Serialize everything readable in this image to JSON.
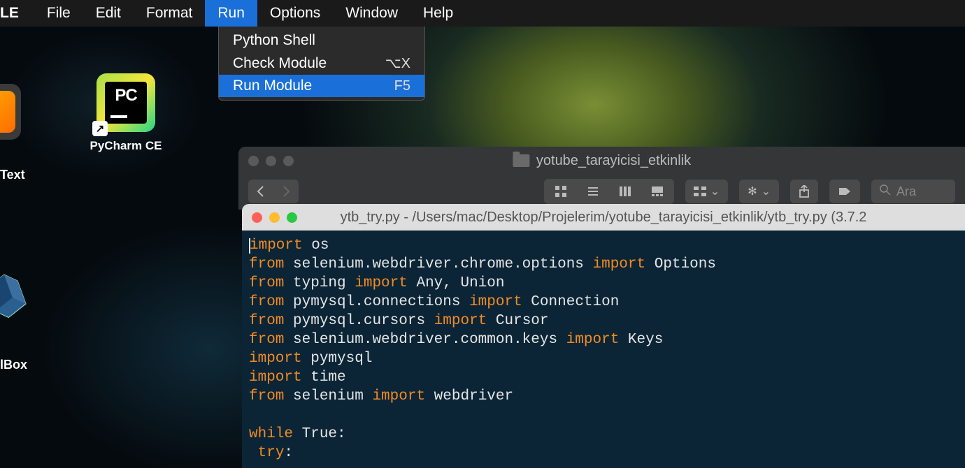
{
  "menubar": {
    "app": "LE",
    "items": [
      "File",
      "Edit",
      "Format",
      "Run",
      "Options",
      "Window",
      "Help"
    ],
    "active_index": 3
  },
  "dropdown": {
    "items": [
      {
        "label": "Python Shell",
        "shortcut": ""
      },
      {
        "label": "Check Module",
        "shortcut": "⌥X"
      },
      {
        "label": "Run Module",
        "shortcut": "F5"
      }
    ],
    "highlight_index": 2
  },
  "desktop": {
    "pycharm_label": "PyCharm CE",
    "sublime_label": "Text",
    "vbox_label": "lBox",
    "pycharm_badge": "PC"
  },
  "finder": {
    "title": "yotube_tarayicisi_etkinlik",
    "search_placeholder": "Ara",
    "icons": {
      "back": "‹",
      "forward": "›",
      "grid": "grid-view-icon",
      "list": "list-view-icon",
      "columns": "columns-view-icon",
      "gallery": "gallery-view-icon",
      "arrange": "arrange-icon",
      "action": "gear-icon",
      "share": "share-icon",
      "tags": "tag-icon",
      "search": "search-icon"
    }
  },
  "editor": {
    "title": "ytb_try.py - /Users/mac/Desktop/Projelerim/yotube_tarayicisi_etkinlik/ytb_try.py (3.7.2",
    "code_tokens": [
      [
        {
          "t": "kw",
          "v": "import"
        },
        {
          "t": "nm",
          "v": " os"
        }
      ],
      [
        {
          "t": "kw",
          "v": "from"
        },
        {
          "t": "nm",
          "v": " selenium.webdriver.chrome.options "
        },
        {
          "t": "kw",
          "v": "import"
        },
        {
          "t": "nm",
          "v": " Options"
        }
      ],
      [
        {
          "t": "kw",
          "v": "from"
        },
        {
          "t": "nm",
          "v": " typing "
        },
        {
          "t": "kw",
          "v": "import"
        },
        {
          "t": "nm",
          "v": " Any, Union"
        }
      ],
      [
        {
          "t": "kw",
          "v": "from"
        },
        {
          "t": "nm",
          "v": " pymysql.connections "
        },
        {
          "t": "kw",
          "v": "import"
        },
        {
          "t": "nm",
          "v": " Connection"
        }
      ],
      [
        {
          "t": "kw",
          "v": "from"
        },
        {
          "t": "nm",
          "v": " pymysql.cursors "
        },
        {
          "t": "kw",
          "v": "import"
        },
        {
          "t": "nm",
          "v": " Cursor"
        }
      ],
      [
        {
          "t": "kw",
          "v": "from"
        },
        {
          "t": "nm",
          "v": " selenium.webdriver.common.keys "
        },
        {
          "t": "kw",
          "v": "import"
        },
        {
          "t": "nm",
          "v": " Keys"
        }
      ],
      [
        {
          "t": "kw",
          "v": "import"
        },
        {
          "t": "nm",
          "v": " pymysql"
        }
      ],
      [
        {
          "t": "kw",
          "v": "import"
        },
        {
          "t": "nm",
          "v": " time"
        }
      ],
      [
        {
          "t": "kw",
          "v": "from"
        },
        {
          "t": "nm",
          "v": " selenium "
        },
        {
          "t": "kw",
          "v": "import"
        },
        {
          "t": "nm",
          "v": " webdriver"
        }
      ],
      [
        {
          "t": "nm",
          "v": ""
        }
      ],
      [
        {
          "t": "kw",
          "v": "while"
        },
        {
          "t": "nm",
          "v": " True:"
        }
      ],
      [
        {
          "t": "nm",
          "v": " "
        },
        {
          "t": "kw",
          "v": "try"
        },
        {
          "t": "nm",
          "v": ":"
        }
      ]
    ]
  }
}
